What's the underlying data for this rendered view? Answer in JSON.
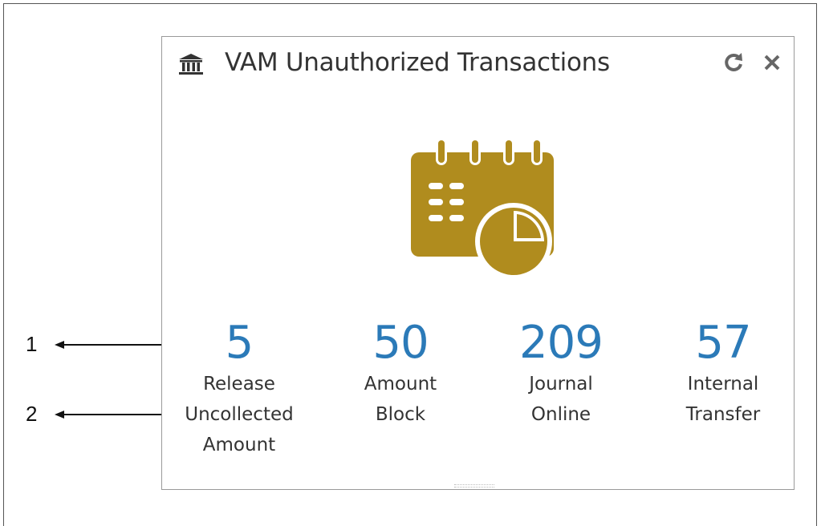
{
  "widget": {
    "title": "VAM Unauthorized Transactions",
    "header_icon": "bank-icon",
    "actions": [
      {
        "name": "refresh",
        "icon": "refresh-icon"
      },
      {
        "name": "close",
        "icon": "close-icon"
      }
    ],
    "hero_icon": "calendar-chart-icon",
    "accent_color": "#b08c1e",
    "value_color": "#2b7ab8",
    "metrics": [
      {
        "value": "5",
        "label": "Release\nUncollected\nAmount"
      },
      {
        "value": "50",
        "label": "Amount\nBlock"
      },
      {
        "value": "209",
        "label": "Journal\nOnline"
      },
      {
        "value": "57",
        "label": "Internal\nTransfer"
      }
    ]
  },
  "callouts": [
    {
      "number": "1"
    },
    {
      "number": "2"
    }
  ]
}
